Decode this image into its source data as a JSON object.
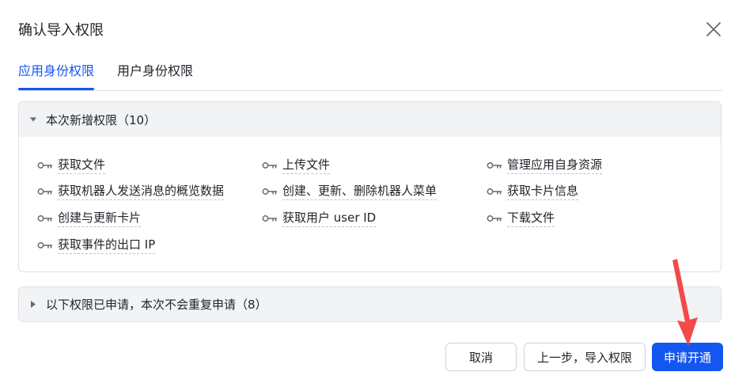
{
  "dialog": {
    "title": "确认导入权限"
  },
  "tabs": [
    {
      "label": "应用身份权限",
      "active": true
    },
    {
      "label": "用户身份权限",
      "active": false
    }
  ],
  "new_permissions": {
    "header": "本次新增权限（10）",
    "items": [
      "获取文件",
      "上传文件",
      "管理应用自身资源",
      "获取机器人发送消息的概览数据",
      "创建、更新、删除机器人菜单",
      "获取卡片信息",
      "创建与更新卡片",
      "获取用户 user ID",
      "下载文件",
      "获取事件的出口 IP"
    ]
  },
  "applied_permissions": {
    "header": "以下权限已申请，本次不会重复申请（8）"
  },
  "footer": {
    "cancel_label": "取消",
    "back_label": "上一步，导入权限",
    "submit_label": "申请开通"
  },
  "colors": {
    "accent": "#1456f0",
    "annotation_arrow": "#f24a4a"
  }
}
